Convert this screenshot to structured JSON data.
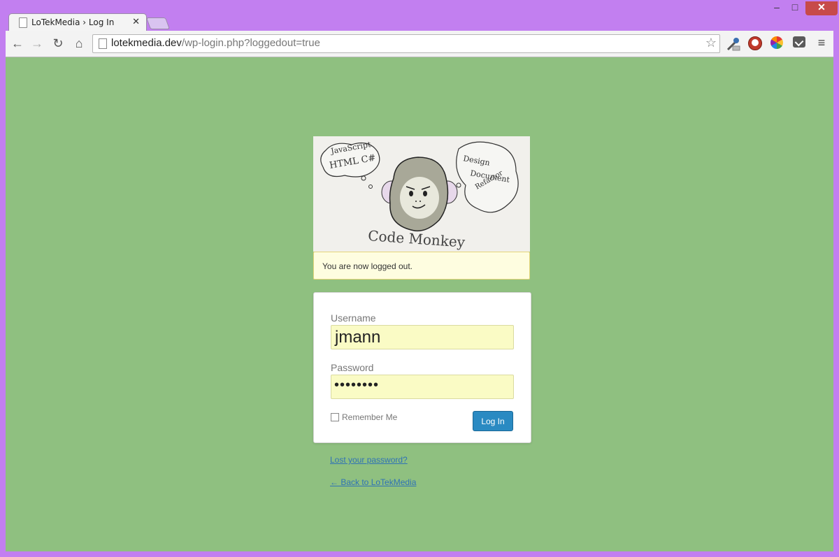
{
  "browser": {
    "tab_title": "LoTekMedia › Log In",
    "tab_close": "✕",
    "url_host": "lotekmedia.dev",
    "url_path": "/wp-login.php?loggedout=true",
    "window_minimize": "–",
    "window_maximize": "□",
    "window_close": "✕",
    "icons": [
      "back-icon",
      "forward-icon",
      "reload-icon",
      "home-icon",
      "page-icon",
      "star-icon",
      "eyedropper-icon",
      "stop-icon",
      "color-wheel-icon",
      "pocket-icon",
      "menu-icon"
    ]
  },
  "logo": {
    "caption": "Code Monkey",
    "bubble_left": [
      "JavaScript",
      "HTML C#"
    ],
    "bubble_right": [
      "Design",
      "Document",
      "Refactor"
    ]
  },
  "notice": {
    "message": "You are now logged out."
  },
  "login": {
    "username_label": "Username",
    "username_value": "jmann",
    "password_label": "Password",
    "password_value": "••••••••",
    "remember_label": "Remember Me",
    "submit_label": "Log In"
  },
  "links": {
    "lost_password": "Lost your password?",
    "back_to_site": "← Back to LoTekMedia"
  },
  "colors": {
    "window_frame": "#c27ff0",
    "page_background": "#8fc080",
    "notice_background": "#fefde0",
    "field_autofill": "#fafbc5",
    "button_primary": "#2a8ac2",
    "link": "#2f72b5"
  }
}
